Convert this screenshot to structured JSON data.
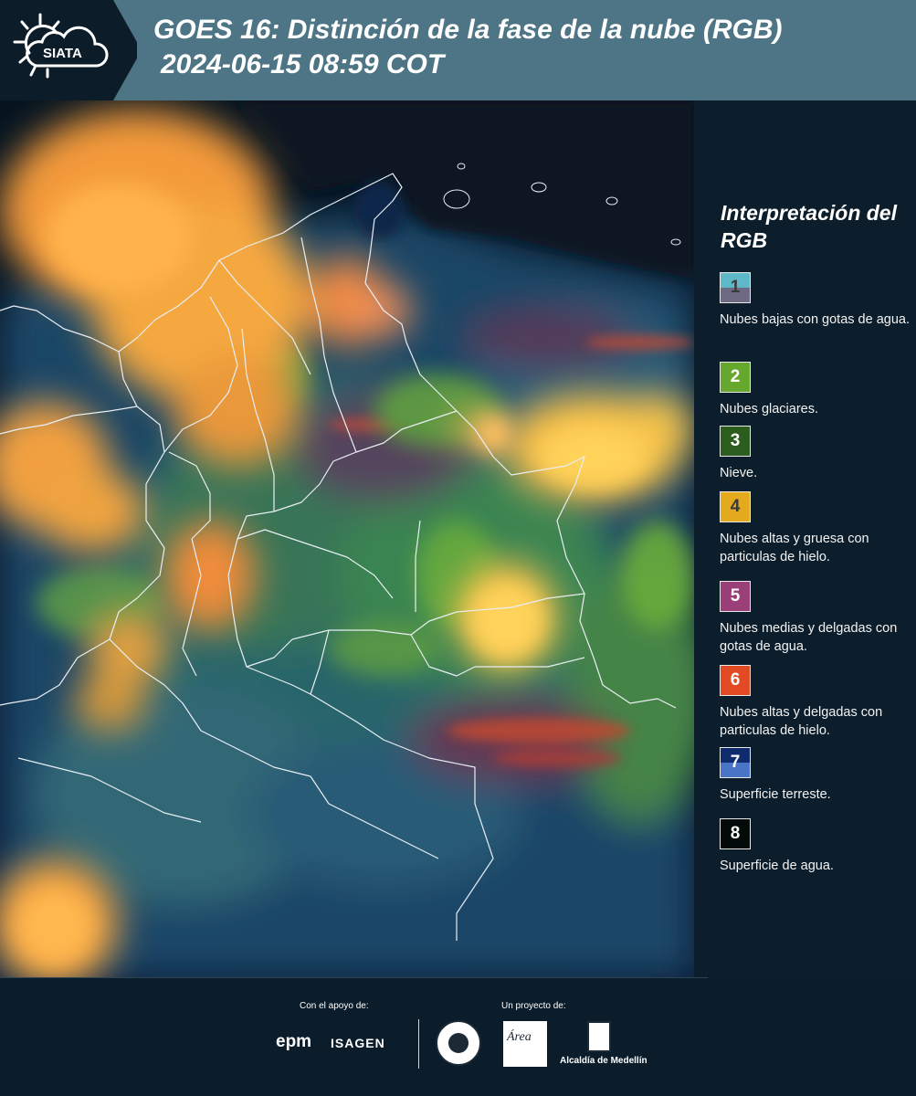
{
  "header": {
    "logo_text": "SIATA",
    "title_line1": "GOES 16: Distinción de la fase de la nube (RGB)",
    "title_line2": "2024-06-15 08:59 COT"
  },
  "legend": {
    "title": "Interpretación del RGB",
    "items": [
      {
        "number": "1",
        "label": "Nubes bajas con gotas de agua.",
        "color_top": "#5fb8c8",
        "color_bottom": "#6e6a83"
      },
      {
        "number": "2",
        "label": "Nubes glaciares.",
        "color_top": "#66a82e",
        "color_bottom": "#66a82e"
      },
      {
        "number": "3",
        "label": "Nieve.",
        "color_top": "#2b5e1e",
        "color_bottom": "#2b5e1e"
      },
      {
        "number": "4",
        "label": "Nubes altas y gruesa con particulas de hielo.",
        "color_top": "#e2aa1c",
        "color_bottom": "#e2aa1c"
      },
      {
        "number": "5",
        "label": "Nubes medias y delgadas con gotas de agua.",
        "color_top": "#9b3f78",
        "color_bottom": "#9b3f78"
      },
      {
        "number": "6",
        "label": "Nubes altas y delgadas con particulas de hielo.",
        "color_top": "#e24a24",
        "color_bottom": "#e24a24"
      },
      {
        "number": "7",
        "label": "Superficie terreste.",
        "color_top": "#102a6e",
        "color_bottom": "#4a74c6"
      },
      {
        "number": "8",
        "label": "Superficie de agua.",
        "color_top": "#030b0a",
        "color_bottom": "#030b0a"
      }
    ]
  },
  "footer": {
    "support_label": "Con el apoyo de:",
    "project_label": "Un proyecto de:",
    "epm": "epm",
    "isagen": "ISAGEN",
    "area_logo": "Área",
    "medellin": "Alcaldía de Medellín"
  }
}
